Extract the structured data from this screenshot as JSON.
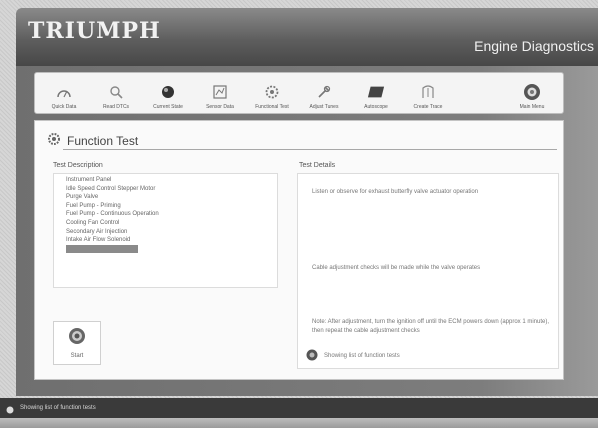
{
  "brand": "TRIUMPH",
  "app_title": "Engine Diagnostics",
  "toolbar": {
    "items": [
      {
        "label": "Quick Data",
        "icon": "quick-data-icon"
      },
      {
        "label": "Read DTCs",
        "icon": "read-dtcs-icon"
      },
      {
        "label": "Current State",
        "icon": "current-state-icon"
      },
      {
        "label": "Sensor Data",
        "icon": "sensor-data-icon"
      },
      {
        "label": "Functional Test",
        "icon": "functional-test-icon"
      },
      {
        "label": "Adjust Tunes",
        "icon": "adjust-tunes-icon"
      },
      {
        "label": "Autoscope",
        "icon": "autoscope-icon"
      },
      {
        "label": "Create Trace",
        "icon": "create-trace-icon"
      }
    ],
    "home": {
      "label": "Main Menu",
      "icon": "main-menu-icon"
    }
  },
  "function_test": {
    "title": "Function Test",
    "list_label": "Test Description",
    "details_label": "Test Details",
    "tests": [
      "Instrument Panel",
      "Idle Speed Control Stepper Motor",
      "Purge Valve",
      "Fuel Pump - Priming",
      "Fuel Pump - Continuous Operation",
      "Cooling Fan Control",
      "Secondary Air Injection",
      "Intake Air Flow Solenoid",
      ""
    ],
    "selected_index": 8,
    "detail_lines": [
      "Listen or observe for exhaust butterfly valve actuator operation",
      "Cable adjustment checks will be made while the valve operates",
      "Note: After adjustment, turn the ignition off until the ECM powers down (approx 1 minute), then repeat the cable adjustment checks"
    ],
    "status_text": "Showing list of function tests",
    "start_label": "Start"
  },
  "statusbar": {
    "text": "Showing list of function tests"
  }
}
